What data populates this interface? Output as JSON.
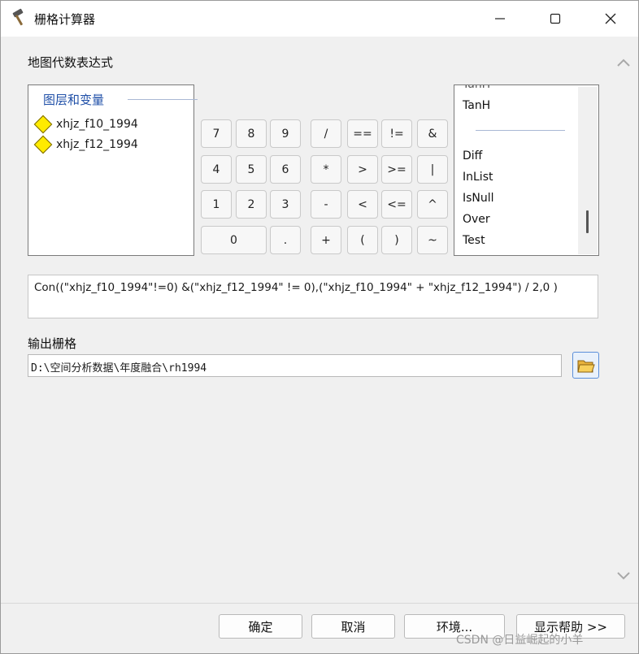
{
  "window": {
    "title": "栅格计算器"
  },
  "titlebar": {
    "minimize": "—",
    "maximize": "☐",
    "close": "✕"
  },
  "expression_section": {
    "label": "地图代数表达式"
  },
  "layers": {
    "header": "图层和变量",
    "items": [
      "xhjz_f10_1994",
      "xhjz_f12_1994"
    ]
  },
  "calculator": {
    "rows": [
      [
        "7",
        "8",
        "9",
        "/",
        "==",
        "!=",
        "&"
      ],
      [
        "4",
        "5",
        "6",
        "*",
        ">",
        ">=",
        "|"
      ],
      [
        "1",
        "2",
        "3",
        "-",
        "<",
        "<=",
        "^"
      ],
      [
        "0",
        ".",
        "+",
        "(",
        ")",
        "~"
      ]
    ]
  },
  "functions": {
    "partial_top": "TanH",
    "items_top": [
      "TanH"
    ],
    "items_bottom": [
      "Diff",
      "InList",
      "IsNull",
      "Over",
      "Test"
    ]
  },
  "expression": {
    "value": "Con((\"xhjz_f10_1994\"!=0) &(\"xhjz_f12_1994\" != 0),(\"xhjz_f10_1994\" + \"xhjz_f12_1994\") / 2,0 )"
  },
  "output": {
    "label": "输出栅格",
    "value": "D:\\空间分析数据\\年度融合\\rh1994"
  },
  "buttons": {
    "ok": "确定",
    "cancel": "取消",
    "environments": "环境...",
    "show_help": "显示帮助 >>"
  },
  "watermark": "CSDN @日益崛起的小羊",
  "colors": {
    "link_blue": "#2050a8",
    "diamond_yellow": "#ffeb00"
  }
}
